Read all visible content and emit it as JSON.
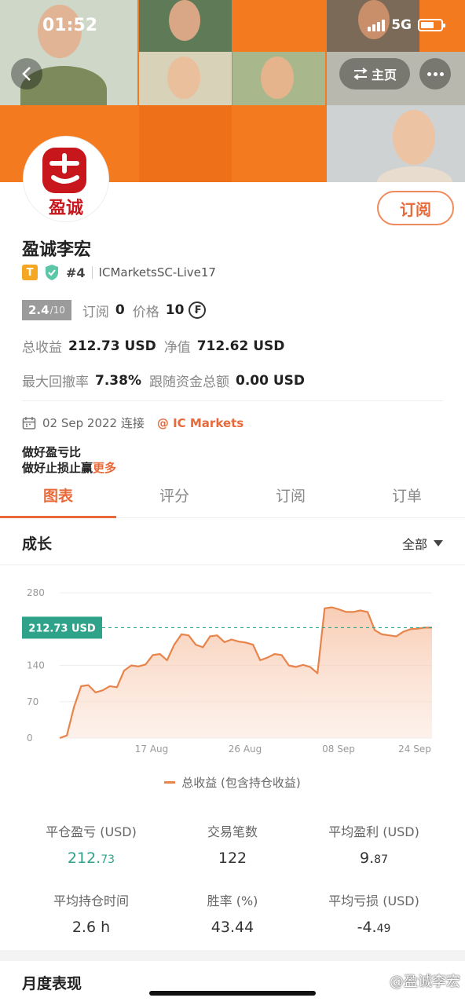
{
  "status_bar": {
    "time": "01:52",
    "network": "5G"
  },
  "header": {
    "home_label": "主页"
  },
  "profile": {
    "avatar_text": "盈诚",
    "subscribe_label": "订阅",
    "name": "盈诚李宏",
    "tier_badge": "T",
    "rank": "#4",
    "account": "ICMarketsSC-Live17",
    "rating": "2.4",
    "rating_max": "/10",
    "subs_label": "订阅",
    "subs_value": "0",
    "price_label": "价格",
    "price_value": "10",
    "total_profit_label": "总收益",
    "total_profit_value": "212.73 USD",
    "equity_label": "净值",
    "equity_value": "712.62 USD",
    "max_drawdown_label": "最大回撤率",
    "max_drawdown_value": "7.38%",
    "follow_funds_label": "跟随资金总额",
    "follow_funds_value": "0.00 USD",
    "connect_date": "02 Sep 2022 连接",
    "broker": "@ IC Markets",
    "bio_line1": "做好盈亏比",
    "bio_line2": "做好止损止赢",
    "bio_more": "更多"
  },
  "tabs": [
    "图表",
    "评分",
    "订阅",
    "订单"
  ],
  "growth": {
    "title": "成长",
    "filter": "全部"
  },
  "chart_data": {
    "type": "area",
    "x_ticks": [
      "17 Aug",
      "26 Aug",
      "08 Sep",
      "24 Sep"
    ],
    "y_ticks": [
      "280",
      "140",
      "70",
      "0"
    ],
    "ylim": [
      0,
      280
    ],
    "current_label": "212.73 USD",
    "current_value": 212.73,
    "series": [
      {
        "name": "总收益 (包含持仓收益)",
        "values": [
          0,
          5,
          60,
          100,
          102,
          88,
          92,
          100,
          98,
          130,
          140,
          138,
          142,
          160,
          162,
          150,
          180,
          200,
          198,
          180,
          175,
          196,
          198,
          185,
          190,
          186,
          184,
          180,
          150,
          155,
          162,
          160,
          140,
          137,
          141,
          137,
          125,
          250,
          252,
          248,
          243,
          243,
          246,
          243,
          208,
          200,
          198,
          196,
          205,
          210,
          211,
          213,
          212.73
        ]
      }
    ],
    "legend": "总收益 (包含持仓收益)"
  },
  "stats": {
    "closed_pl_label": "平仓盈亏 (USD)",
    "closed_pl_main": "212.",
    "closed_pl_dec": "73",
    "trades_label": "交易笔数",
    "trades_value": "122",
    "avg_profit_label": "平均盈利 (USD)",
    "avg_profit_main": "9.",
    "avg_profit_dec": "87",
    "avg_hold_label": "平均持仓时间",
    "avg_hold_value": "2.6 h",
    "winrate_label": "胜率 (%)",
    "winrate_value": "43.44",
    "avg_loss_label": "平均亏损 (USD)",
    "avg_loss_main": "-4.",
    "avg_loss_dec": "49"
  },
  "monthly_title": "月度表现",
  "watermark": "@盈诚李宏",
  "colors": {
    "accent": "#e86a3a",
    "banner": "#f47a20",
    "chart_line": "#e8844a",
    "positive": "#2fa38a"
  }
}
